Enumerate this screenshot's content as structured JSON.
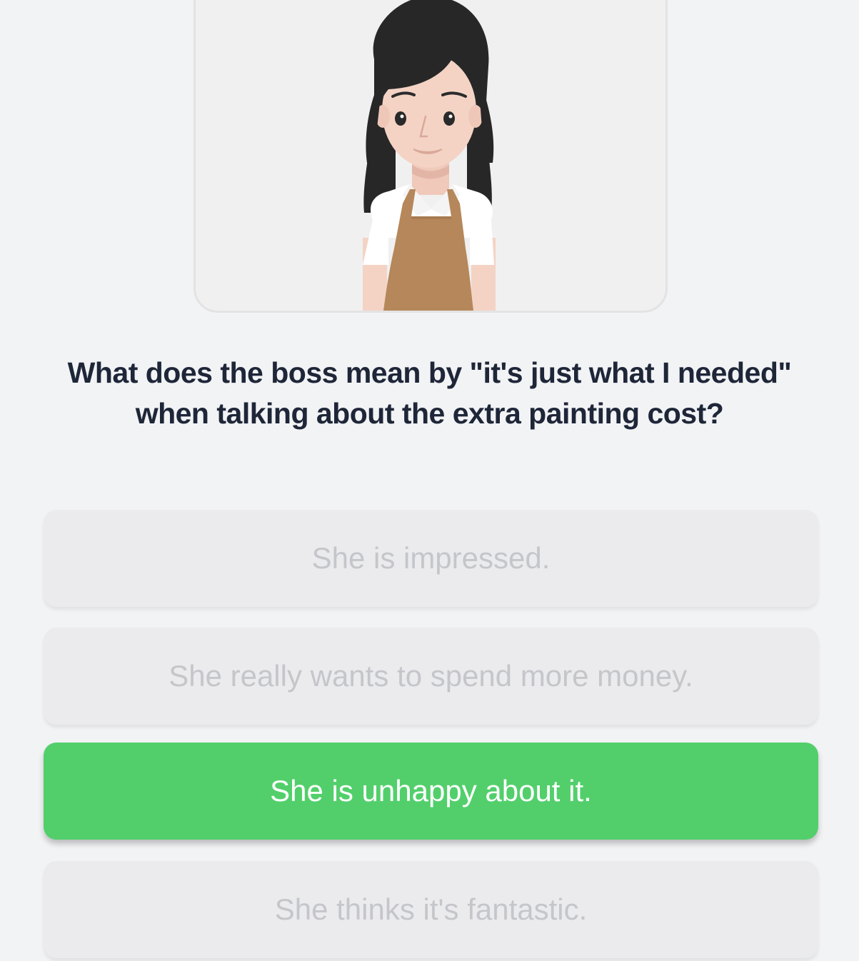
{
  "character": {
    "icon": "woman-barista-avatar-icon"
  },
  "question": {
    "text": "What does the boss mean by \"it's just what I needed\" when talking about the extra painting cost?"
  },
  "options": [
    {
      "label": "She is impressed.",
      "selected": false
    },
    {
      "label": "She really wants to spend more money.",
      "selected": false
    },
    {
      "label": "She is unhappy about it.",
      "selected": true
    },
    {
      "label": "She thinks it's fantastic.",
      "selected": false
    }
  ],
  "colors": {
    "background": "#f2f3f5",
    "selected_option": "#52cf6b",
    "unselected_option": "#ebebed",
    "question_text": "#1e2638",
    "apron": "#b5875a",
    "hair": "#272727",
    "skin": "#f4d3c5"
  }
}
